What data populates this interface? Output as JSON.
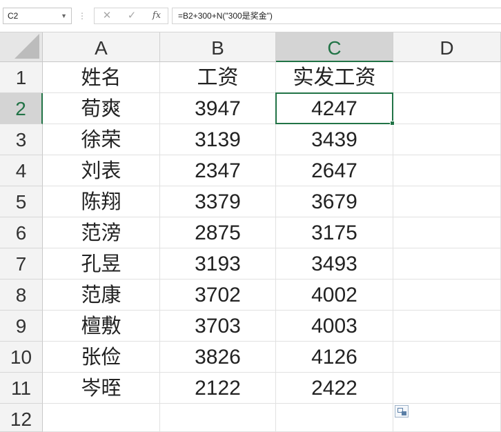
{
  "formula_bar": {
    "name_box": "C2",
    "cancel_glyph": "✕",
    "enter_glyph": "✓",
    "fx_label": "fx",
    "formula": "=B2+300+N(\"300是奖金\")"
  },
  "sheet": {
    "columns": [
      "A",
      "B",
      "C",
      "D"
    ],
    "rows": [
      "1",
      "2",
      "3",
      "4",
      "5",
      "6",
      "7",
      "8",
      "9",
      "10",
      "11",
      "12"
    ],
    "selected_cell": "C2",
    "data": [
      [
        "姓名",
        "工资",
        "实发工资"
      ],
      [
        "荀爽",
        "3947",
        "4247"
      ],
      [
        "徐荣",
        "3139",
        "3439"
      ],
      [
        "刘表",
        "2347",
        "2647"
      ],
      [
        "陈翔",
        "3379",
        "3679"
      ],
      [
        "范滂",
        "2875",
        "3175"
      ],
      [
        "孔昱",
        "3193",
        "3493"
      ],
      [
        "范康",
        "3702",
        "4002"
      ],
      [
        "檀敷",
        "3703",
        "4003"
      ],
      [
        "张俭",
        "3826",
        "4126"
      ],
      [
        "岑晊",
        "2122",
        "2422"
      ]
    ]
  },
  "colors": {
    "accent_green": "#217346",
    "header_bg": "#f3f3f3",
    "selected_header_bg": "#d4d4d4"
  },
  "icons": {
    "quick_analysis": "quick-analysis-icon"
  }
}
